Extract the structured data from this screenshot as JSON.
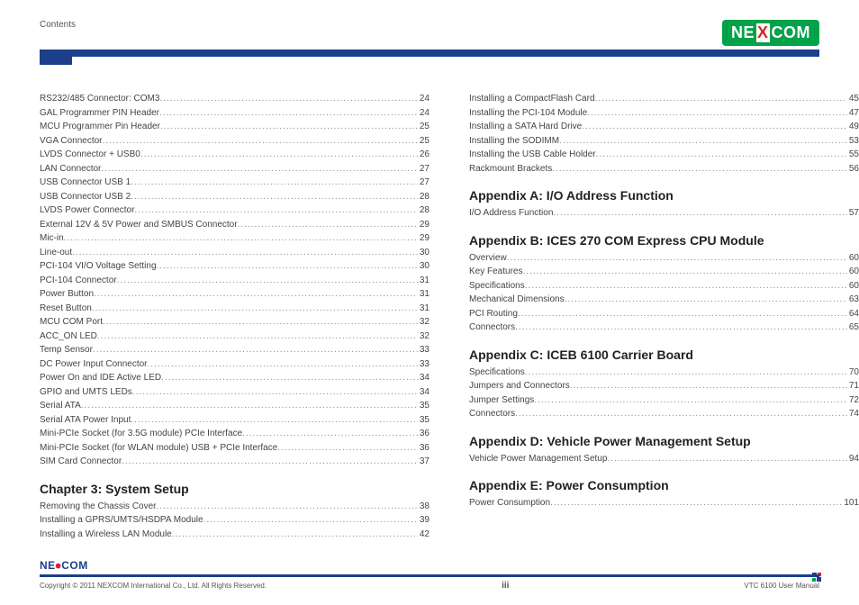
{
  "header": {
    "contents_label": "Contents",
    "logo_letters": {
      "pre": "NE",
      "x": "X",
      "post": "COM"
    }
  },
  "col1_a": [
    {
      "label": "RS232/485 Connector: COM3",
      "pg": "24"
    },
    {
      "label": "GAL Programmer PIN Header",
      "pg": "24"
    },
    {
      "label": "MCU Programmer Pin Header",
      "pg": "25"
    },
    {
      "label": "VGA Connector",
      "pg": "25"
    },
    {
      "label": "LVDS Connector + USB0",
      "pg": "26"
    },
    {
      "label": "LAN Connector",
      "pg": "27"
    },
    {
      "label": "USB Connector USB 1",
      "pg": "27"
    },
    {
      "label": "USB Connector USB 2",
      "pg": "28"
    },
    {
      "label": "LVDS Power Connector",
      "pg": "28"
    },
    {
      "label": "External 12V & 5V Power and SMBUS Connector",
      "pg": "29"
    },
    {
      "label": "Mic-in",
      "pg": "29"
    },
    {
      "label": "Line-out",
      "pg": "30"
    },
    {
      "label": "PCI-104 VI/O Voltage Setting",
      "pg": "30"
    },
    {
      "label": "PCI-104 Connector",
      "pg": "31"
    },
    {
      "label": "Power Button",
      "pg": "31"
    },
    {
      "label": "Reset Button",
      "pg": "31"
    },
    {
      "label": "MCU COM Port",
      "pg": "32"
    },
    {
      "label": "ACC_ON LED",
      "pg": "32"
    },
    {
      "label": "Temp Sensor",
      "pg": "33"
    },
    {
      "label": "DC Power Input Connector",
      "pg": "33"
    },
    {
      "label": "Power On and IDE Active LED",
      "pg": "34"
    },
    {
      "label": "GPIO and UMTS LEDs",
      "pg": "34"
    },
    {
      "label": "Serial ATA",
      "pg": "35"
    },
    {
      "label": "Serial ATA Power Input",
      "pg": "35"
    },
    {
      "label": "Mini-PCIe Socket (for 3.5G module) PCIe Interface",
      "pg": "36"
    },
    {
      "label": "Mini-PCIe Socket (for WLAN module) USB + PCIe Interface",
      "pg": "36"
    },
    {
      "label": "SIM Card Connector",
      "pg": "37"
    }
  ],
  "col1_section_b_title": "Chapter 3: System Setup",
  "col1_b": [
    {
      "label": "Removing the Chassis Cover",
      "pg": "38"
    },
    {
      "label": "Installing a GPRS/UMTS/HSDPA Module",
      "pg": "39"
    },
    {
      "label": "Installing a Wireless LAN Module",
      "pg": "42"
    }
  ],
  "col2_a": [
    {
      "label": "Installing a CompactFlash Card",
      "pg": "45"
    },
    {
      "label": "Installing the PCI-104 Module",
      "pg": "47"
    },
    {
      "label": "Installing a SATA Hard Drive",
      "pg": "49"
    },
    {
      "label": "Installing the SODIMM",
      "pg": "53"
    },
    {
      "label": "Installing the USB Cable Holder",
      "pg": "55"
    },
    {
      "label": "Rackmount Brackets",
      "pg": "56"
    }
  ],
  "col2_sections": [
    {
      "title": "Appendix A: I/O Address Function",
      "items": [
        {
          "label": "I/O Address Function",
          "pg": "57"
        }
      ]
    },
    {
      "title": "Appendix B: ICES 270 COM Express CPU Module",
      "items": [
        {
          "label": "Overview",
          "pg": "60"
        },
        {
          "label": "Key Features",
          "pg": "60"
        },
        {
          "label": "Specifications",
          "pg": "60"
        },
        {
          "label": "Mechanical Dimensions",
          "pg": "63"
        },
        {
          "label": "PCI Routing",
          "pg": "64"
        },
        {
          "label": "Connectors",
          "pg": "65"
        }
      ]
    },
    {
      "title": "Appendix C: ICEB 6100 Carrier Board",
      "items": [
        {
          "label": "Specifications",
          "pg": "70"
        },
        {
          "label": "Jumpers and Connectors",
          "pg": "71"
        },
        {
          "label": "Jumper Settings",
          "pg": "72"
        },
        {
          "label": "Connectors",
          "pg": "74"
        }
      ]
    },
    {
      "title": "Appendix D: Vehicle Power Management Setup",
      "items": [
        {
          "label": "Vehicle Power Management Setup",
          "pg": "94"
        }
      ]
    },
    {
      "title": "Appendix E: Power Consumption",
      "items": [
        {
          "label": "Power Consumption",
          "pg": "101"
        }
      ]
    }
  ],
  "footer": {
    "logo": "NE COM",
    "copyright": "Copyright © 2011 NEXCOM International Co., Ltd. All Rights Reserved.",
    "page": "iii",
    "doc": "VTC 6100 User Manual"
  }
}
